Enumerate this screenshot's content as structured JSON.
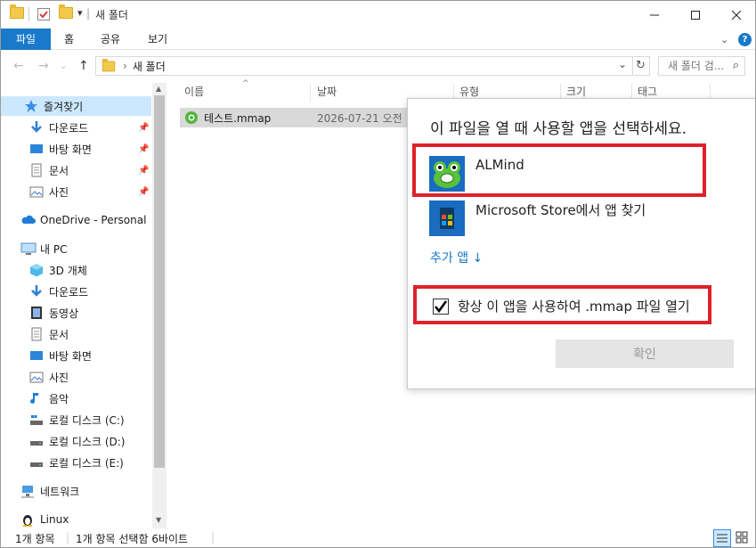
{
  "window": {
    "title": "새 폴더",
    "title_separator": "|",
    "qa_dropdown": "▾"
  },
  "ribbon": {
    "tabs": [
      "파일",
      "홈",
      "공유",
      "보기"
    ],
    "help": "?"
  },
  "address": {
    "crumb_separator": "›",
    "path": "새 폴더",
    "search_placeholder": "새 폴더 검...",
    "search_symbol": "⌕",
    "refresh_symbol": "↻",
    "dropdown_symbol": "⌄"
  },
  "sidebar": {
    "items": [
      {
        "label": "즐겨찾기",
        "icon": "star-icon"
      },
      {
        "label": "다운로드",
        "icon": "download-icon",
        "pinned": true
      },
      {
        "label": "바탕 화면",
        "icon": "desktop-icon",
        "pinned": true
      },
      {
        "label": "문서",
        "icon": "document-icon",
        "pinned": true
      },
      {
        "label": "사진",
        "icon": "picture-icon",
        "pinned": true
      },
      {
        "label": "OneDrive - Personal",
        "icon": "cloud-icon"
      },
      {
        "label": "내 PC",
        "icon": "pc-icon"
      },
      {
        "label": "3D 개체",
        "icon": "cube-icon"
      },
      {
        "label": "다운로드",
        "icon": "download-icon"
      },
      {
        "label": "동영상",
        "icon": "video-icon"
      },
      {
        "label": "문서",
        "icon": "document-icon"
      },
      {
        "label": "바탕 화면",
        "icon": "desktop-icon"
      },
      {
        "label": "사진",
        "icon": "picture-icon"
      },
      {
        "label": "음악",
        "icon": "music-icon"
      },
      {
        "label": "로컬 디스크 (C:)",
        "icon": "system-drive-icon"
      },
      {
        "label": "로컬 디스크 (D:)",
        "icon": "drive-icon"
      },
      {
        "label": "로컬 디스크 (E:)",
        "icon": "drive-icon"
      },
      {
        "label": "네트워크",
        "icon": "network-icon"
      },
      {
        "label": "Linux",
        "icon": "linux-icon"
      }
    ]
  },
  "columns": [
    "이름",
    "날짜",
    "유형",
    "크기",
    "태그"
  ],
  "files": [
    {
      "name": "테스트.mmap",
      "date": "2026-07-21 오전"
    }
  ],
  "status": {
    "count": "1개 항목",
    "selection": "1개 항목 선택함 6바이트"
  },
  "dialog": {
    "title": "이 파일을 열 때 사용할 앱을 선택하세요.",
    "apps": [
      {
        "name": "ALMind",
        "icon": "almind-icon"
      },
      {
        "name": "Microsoft Store에서 앱 찾기",
        "icon": "store-icon"
      }
    ],
    "more_apps": "추가 앱 ↓",
    "always_use_label": "항상 이 앱을 사용하여 .mmap 파일 열기",
    "always_use_checked": true,
    "ok_label": "확인"
  },
  "colors": {
    "accent": "#1979ca",
    "highlight_box": "#e0202a",
    "selection": "#cce8ff"
  }
}
